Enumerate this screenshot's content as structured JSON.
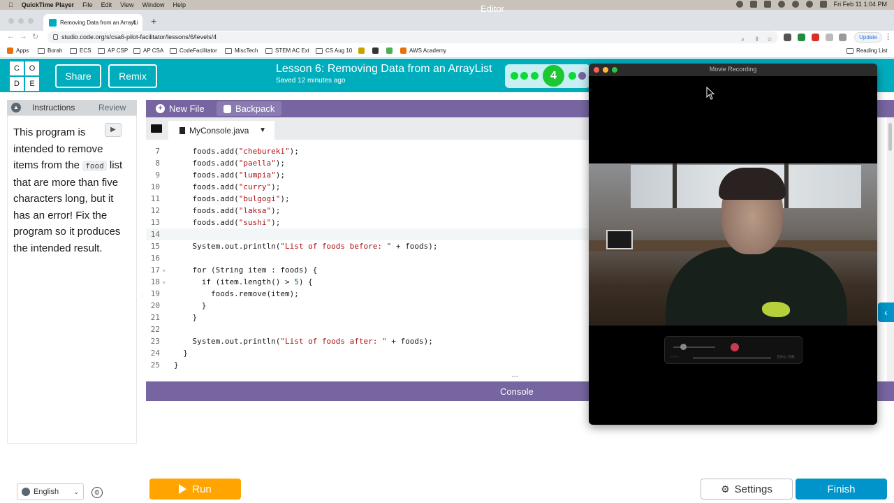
{
  "menubar": {
    "app": "QuickTime Player",
    "menus": [
      "File",
      "Edit",
      "View",
      "Window",
      "Help"
    ],
    "clock": "Fri Feb 11  1:04 PM"
  },
  "browser": {
    "tab_title": "Removing Data from an ArrayLi",
    "url": "studio.code.org/s/csa6-pilot-facilitator/lessons/6/levels/4",
    "update_label": "Update",
    "bookmarks": [
      "Apps",
      "Borah",
      "ECS",
      "AP CSP",
      "AP CSA",
      "CodeFacilitator",
      "MiscTech",
      "STEM AC Ext",
      "CS Aug 10",
      "AWS Academy"
    ],
    "reading_list": "Reading List"
  },
  "header": {
    "logo_letters": [
      "C",
      "O",
      "D",
      "E"
    ],
    "share_label": "Share",
    "remix_label": "Remix",
    "lesson_title": "Lesson 6: Removing Data from an ArrayList",
    "saved": "Saved 12 minutes ago",
    "current_level": "4"
  },
  "instructions": {
    "tab_instructions": "Instructions",
    "tab_review": "Review",
    "text_part1": "This program is intended to remove items from the ",
    "code_word": "food",
    "text_part2": " list that are more than five characters long, but it has an error! Fix the program so it produces the intended result.",
    "language": "English",
    "copyright": "©"
  },
  "editor": {
    "new_file_label": "New File",
    "backpack_label": "Backpack",
    "title": "Editor",
    "filename": "MyConsole.java",
    "lines": [
      {
        "n": "7",
        "text": "    foods.add(\"chebureki\");"
      },
      {
        "n": "8",
        "text": "    foods.add(\"paella\");"
      },
      {
        "n": "9",
        "text": "    foods.add(\"lumpia\");"
      },
      {
        "n": "10",
        "text": "    foods.add(\"curry\");"
      },
      {
        "n": "11",
        "text": "    foods.add(\"bulgogi\");"
      },
      {
        "n": "12",
        "text": "    foods.add(\"laksa\");"
      },
      {
        "n": "13",
        "text": "    foods.add(\"sushi\");"
      },
      {
        "n": "14",
        "text": ""
      },
      {
        "n": "15",
        "text": "    System.out.println(\"List of foods before: \" + foods);"
      },
      {
        "n": "16",
        "text": ""
      },
      {
        "n": "17",
        "text": "    for (String item : foods) {"
      },
      {
        "n": "18",
        "text": "      if (item.length() > 5) {"
      },
      {
        "n": "19",
        "text": "        foods.remove(item);"
      },
      {
        "n": "20",
        "text": "      }"
      },
      {
        "n": "21",
        "text": "    }"
      },
      {
        "n": "22",
        "text": ""
      },
      {
        "n": "23",
        "text": "    System.out.println(\"List of foods after: \" + foods);"
      },
      {
        "n": "24",
        "text": "  }"
      },
      {
        "n": "25",
        "text": "}"
      }
    ]
  },
  "console": {
    "title": "Console"
  },
  "buttons": {
    "run": "Run",
    "settings": "Settings",
    "finish": "Finish"
  },
  "quicktime": {
    "title": "Movie Recording",
    "size_readout": "Zero KB",
    "time_readout": "--:--"
  },
  "colors": {
    "codeorg_teal": "#00adbc",
    "editor_purple": "#7665a0",
    "run_orange": "#ffa400",
    "finish_blue": "#0094ca"
  }
}
